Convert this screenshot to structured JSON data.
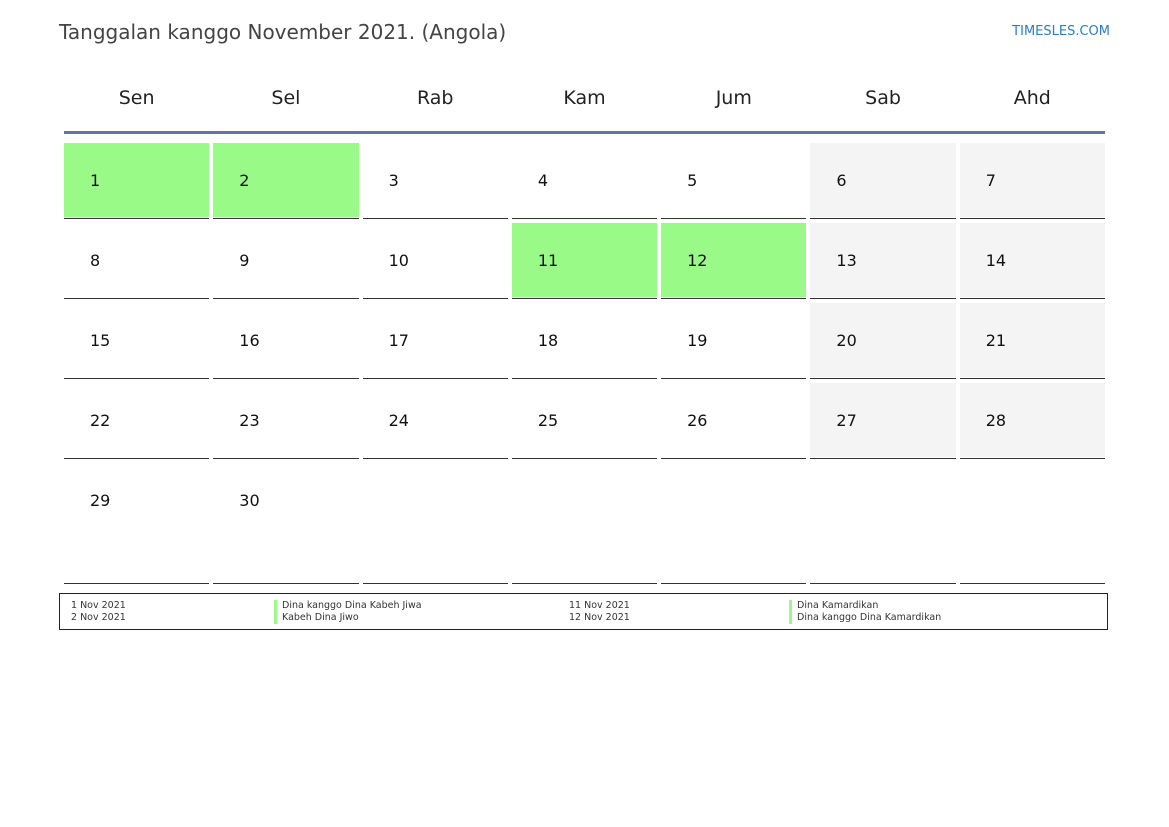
{
  "title": "Tanggalan kanggo November 2021. (Angola)",
  "brand": "TIMESLES.COM",
  "colors": {
    "holiday": "#9afa88",
    "weekend": "#f4f4f4",
    "header_line": "#5b78a0",
    "brand": "#2e7bc4"
  },
  "weekdays": [
    "Sen",
    "Sel",
    "Rab",
    "Kam",
    "Jum",
    "Sab",
    "Ahd"
  ],
  "weeks": [
    [
      {
        "n": "1",
        "type": "holiday"
      },
      {
        "n": "2",
        "type": "holiday"
      },
      {
        "n": "3",
        "type": "normal"
      },
      {
        "n": "4",
        "type": "normal"
      },
      {
        "n": "5",
        "type": "normal"
      },
      {
        "n": "6",
        "type": "weekend"
      },
      {
        "n": "7",
        "type": "weekend"
      }
    ],
    [
      {
        "n": "8",
        "type": "normal"
      },
      {
        "n": "9",
        "type": "normal"
      },
      {
        "n": "10",
        "type": "normal"
      },
      {
        "n": "11",
        "type": "holiday"
      },
      {
        "n": "12",
        "type": "holiday"
      },
      {
        "n": "13",
        "type": "weekend"
      },
      {
        "n": "14",
        "type": "weekend"
      }
    ],
    [
      {
        "n": "15",
        "type": "normal"
      },
      {
        "n": "16",
        "type": "normal"
      },
      {
        "n": "17",
        "type": "normal"
      },
      {
        "n": "18",
        "type": "normal"
      },
      {
        "n": "19",
        "type": "normal"
      },
      {
        "n": "20",
        "type": "weekend"
      },
      {
        "n": "21",
        "type": "weekend"
      }
    ],
    [
      {
        "n": "22",
        "type": "normal"
      },
      {
        "n": "23",
        "type": "normal"
      },
      {
        "n": "24",
        "type": "normal"
      },
      {
        "n": "25",
        "type": "normal"
      },
      {
        "n": "26",
        "type": "normal"
      },
      {
        "n": "27",
        "type": "weekend"
      },
      {
        "n": "28",
        "type": "weekend"
      }
    ],
    [
      {
        "n": "29",
        "type": "normal"
      },
      {
        "n": "30",
        "type": "normal"
      },
      {
        "n": "",
        "type": "empty"
      },
      {
        "n": "",
        "type": "empty"
      },
      {
        "n": "",
        "type": "empty"
      },
      {
        "n": "",
        "type": "empty"
      },
      {
        "n": "",
        "type": "empty"
      }
    ]
  ],
  "legend": {
    "left": {
      "dates": [
        "1 Nov 2021",
        "2 Nov 2021"
      ],
      "names": [
        "Dina kanggo Dina Kabeh Jiwa",
        "Kabeh Dina Jiwo"
      ]
    },
    "right": {
      "dates": [
        "11 Nov 2021",
        "12 Nov 2021"
      ],
      "names": [
        "Dina Kamardikan",
        "Dina kanggo Dina Kamardikan"
      ]
    }
  }
}
